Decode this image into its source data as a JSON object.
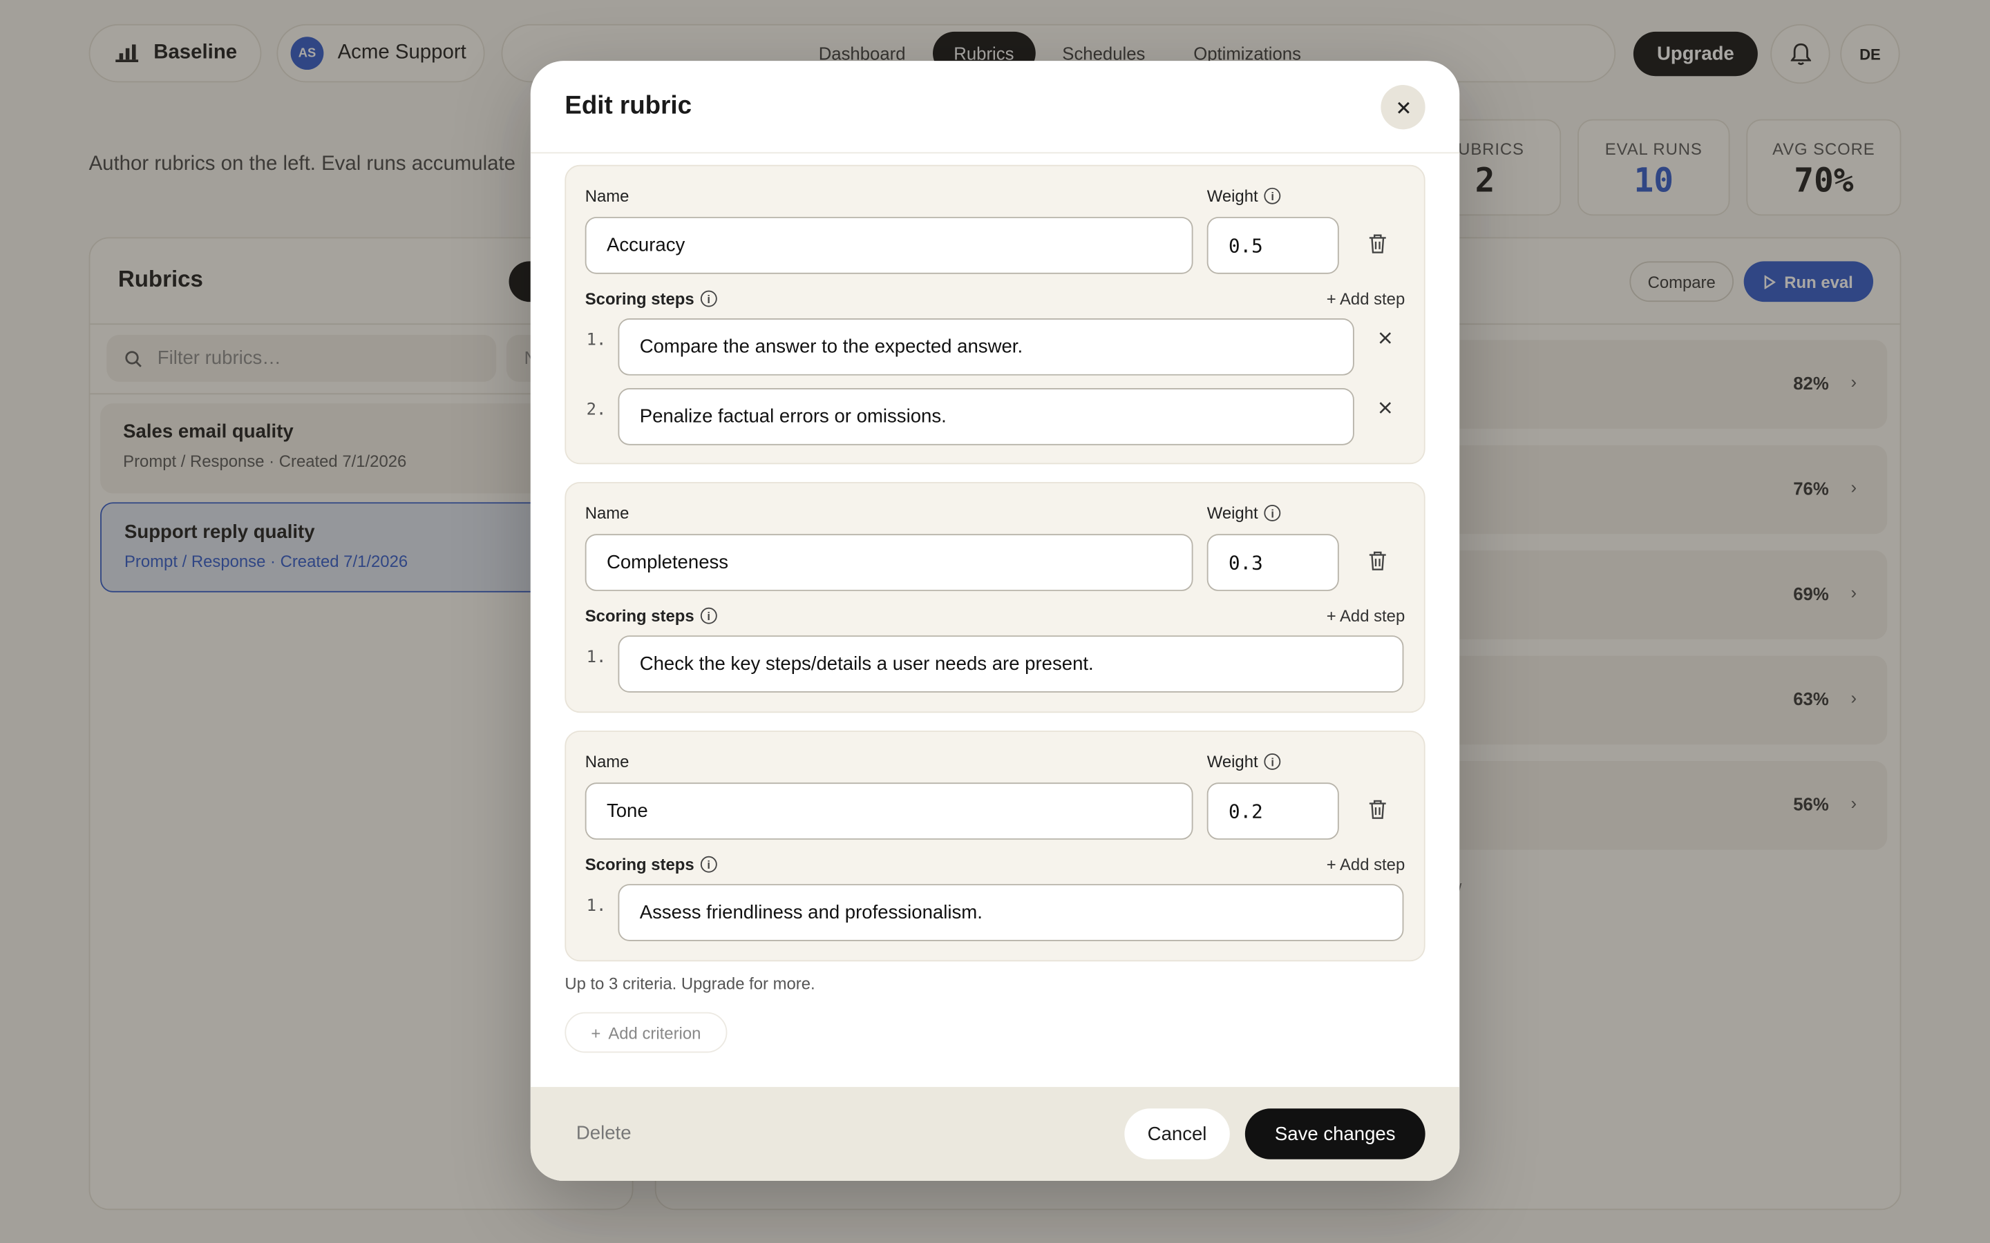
{
  "header": {
    "brand": "Baseline",
    "org_initials": "AS",
    "org_name": "Acme Support",
    "nav": [
      "Dashboard",
      "Rubrics",
      "Schedules",
      "Optimizations"
    ],
    "upgrade": "Upgrade",
    "user_initials": "DE"
  },
  "intro": "Author rubrics on the left. Eval runs accumulate",
  "stats": [
    {
      "label": "RUBRICS",
      "value": "2"
    },
    {
      "label": "EVAL RUNS",
      "value": "10"
    },
    {
      "label": "AVG SCORE",
      "value": "70%"
    }
  ],
  "left_panel": {
    "title": "Rubrics",
    "filter_placeholder": "Filter rubrics…",
    "filter_select": "N",
    "items": [
      {
        "title": "Sales email quality",
        "sub": "Prompt / Response  ·  Created 7/1/2026"
      },
      {
        "title": "Support reply quality",
        "sub": "Prompt / Response  ·  Created 7/1/2026"
      }
    ]
  },
  "right_panel": {
    "compare": "Compare",
    "run_eval": "Run eval",
    "runs": [
      "82%",
      "76%",
      "69%",
      "63%",
      "56%"
    ],
    "legend_fragment": "w"
  },
  "modal": {
    "title": "Edit rubric",
    "name_label": "Name",
    "weight_label": "Weight",
    "steps_label": "Scoring steps",
    "add_step": "+ Add step",
    "criteria": [
      {
        "name": "Accuracy",
        "weight": "0.5",
        "steps": [
          "Compare the answer to the expected answer.",
          "Penalize factual errors or omissions."
        ]
      },
      {
        "name": "Completeness",
        "weight": "0.3",
        "steps": [
          "Check the key steps/details a user needs are present."
        ]
      },
      {
        "name": "Tone",
        "weight": "0.2",
        "steps": [
          "Assess friendliness and professionalism."
        ]
      }
    ],
    "note": "Up to 3 criteria. Upgrade for more.",
    "add_criterion": "Add criterion",
    "delete": "Delete",
    "cancel": "Cancel",
    "save": "Save changes"
  }
}
